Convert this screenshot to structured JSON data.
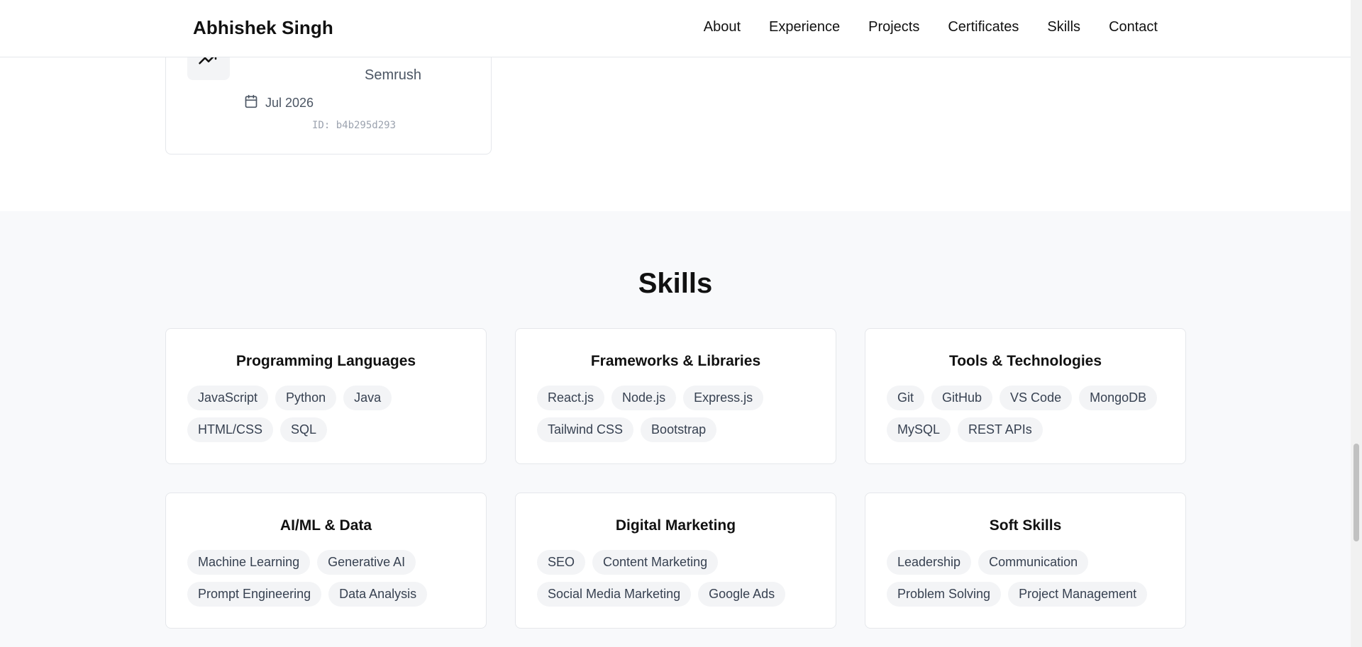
{
  "header": {
    "brand": "Abhishek Singh",
    "nav": [
      "About",
      "Experience",
      "Projects",
      "Certificates",
      "Skills",
      "Contact"
    ]
  },
  "certificate": {
    "issuer": "Semrush",
    "date": "Jul 2026",
    "id": "ID: b4b295d293",
    "icon": "trending-up-icon"
  },
  "skills": {
    "title": "Skills",
    "categories": [
      {
        "title": "Programming Languages",
        "items": [
          "JavaScript",
          "Python",
          "Java",
          "HTML/CSS",
          "SQL"
        ]
      },
      {
        "title": "Frameworks & Libraries",
        "items": [
          "React.js",
          "Node.js",
          "Express.js",
          "Tailwind CSS",
          "Bootstrap"
        ]
      },
      {
        "title": "Tools & Technologies",
        "items": [
          "Git",
          "GitHub",
          "VS Code",
          "MongoDB",
          "MySQL",
          "REST APIs"
        ]
      },
      {
        "title": "AI/ML & Data",
        "items": [
          "Machine Learning",
          "Generative AI",
          "Prompt Engineering",
          "Data Analysis"
        ]
      },
      {
        "title": "Digital Marketing",
        "items": [
          "SEO",
          "Content Marketing",
          "Social Media Marketing",
          "Google Ads"
        ]
      },
      {
        "title": "Soft Skills",
        "items": [
          "Leadership",
          "Communication",
          "Problem Solving",
          "Project Management"
        ]
      }
    ]
  },
  "colors": {
    "section_bg": "#f8f9fb",
    "tag_bg": "#f3f4f6",
    "tag_text": "#374151",
    "border": "#e5e7eb"
  }
}
